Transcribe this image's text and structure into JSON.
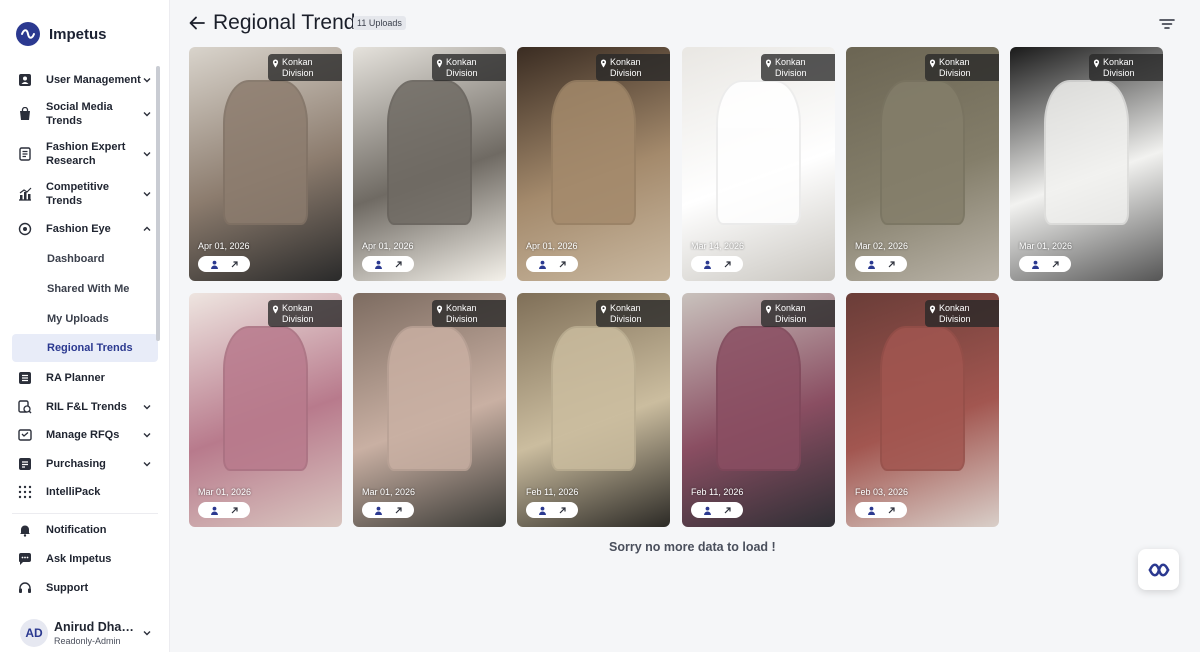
{
  "brand": {
    "name": "Impetus",
    "logo_icon": "impetus-logo-icon",
    "color": "#2b3990"
  },
  "nav": {
    "items": [
      {
        "label": "User Management",
        "icon": "user-management-icon",
        "chevron": "down"
      },
      {
        "label": "Social Media Trends",
        "icon": "shopping-bag-icon",
        "chevron": "down"
      },
      {
        "label": "Fashion Expert Research",
        "icon": "document-icon",
        "chevron": "down"
      },
      {
        "label": "Competitive Trends",
        "icon": "chart-icon",
        "chevron": "down"
      },
      {
        "label": "Fashion Eye",
        "icon": "eye-icon",
        "chevron": "up"
      }
    ],
    "sub_items": [
      "Dashboard",
      "Shared With Me",
      "My Uploads",
      "Regional Trends"
    ],
    "active_sub": "Regional Trends",
    "items_after": [
      {
        "label": "RA Planner",
        "icon": "list-icon",
        "chevron": ""
      },
      {
        "label": "RIL F&L Trends",
        "icon": "trends-icon",
        "chevron": "down"
      },
      {
        "label": "Manage RFQs",
        "icon": "rfq-icon",
        "chevron": "down"
      },
      {
        "label": "Purchasing",
        "icon": "purchasing-icon",
        "chevron": "down"
      },
      {
        "label": "IntelliPack",
        "icon": "grid-dots-icon",
        "chevron": ""
      }
    ],
    "bottom": [
      {
        "label": "Notification",
        "icon": "bell-icon"
      },
      {
        "label": "Ask Impetus",
        "icon": "chat-icon"
      },
      {
        "label": "Support",
        "icon": "headset-icon"
      }
    ]
  },
  "user": {
    "initials": "AD",
    "name": "Anirud Dhadwal",
    "role": "Readonly-Admin"
  },
  "header": {
    "title": "Regional Trends",
    "uploads_badge": "11 Uploads"
  },
  "cards": [
    {
      "location": "Konkan Division",
      "date": "Apr 01, 2026"
    },
    {
      "location": "Konkan Division",
      "date": "Apr 01, 2026"
    },
    {
      "location": "Konkan Division",
      "date": "Apr 01, 2026"
    },
    {
      "location": "Konkan Division",
      "date": "Mar 14, 2026"
    },
    {
      "location": "Konkan Division",
      "date": "Mar 02, 2026"
    },
    {
      "location": "Konkan Division",
      "date": "Mar 01, 2026"
    },
    {
      "location": "Konkan Division",
      "date": "Mar 01, 2026"
    },
    {
      "location": "Konkan Division",
      "date": "Mar 01, 2026"
    },
    {
      "location": "Konkan Division",
      "date": "Feb 11, 2026"
    },
    {
      "location": "Konkan Division",
      "date": "Feb 11, 2026"
    },
    {
      "location": "Konkan Division",
      "date": "Feb 03, 2026"
    }
  ],
  "end_message": "Sorry no more data to load !"
}
